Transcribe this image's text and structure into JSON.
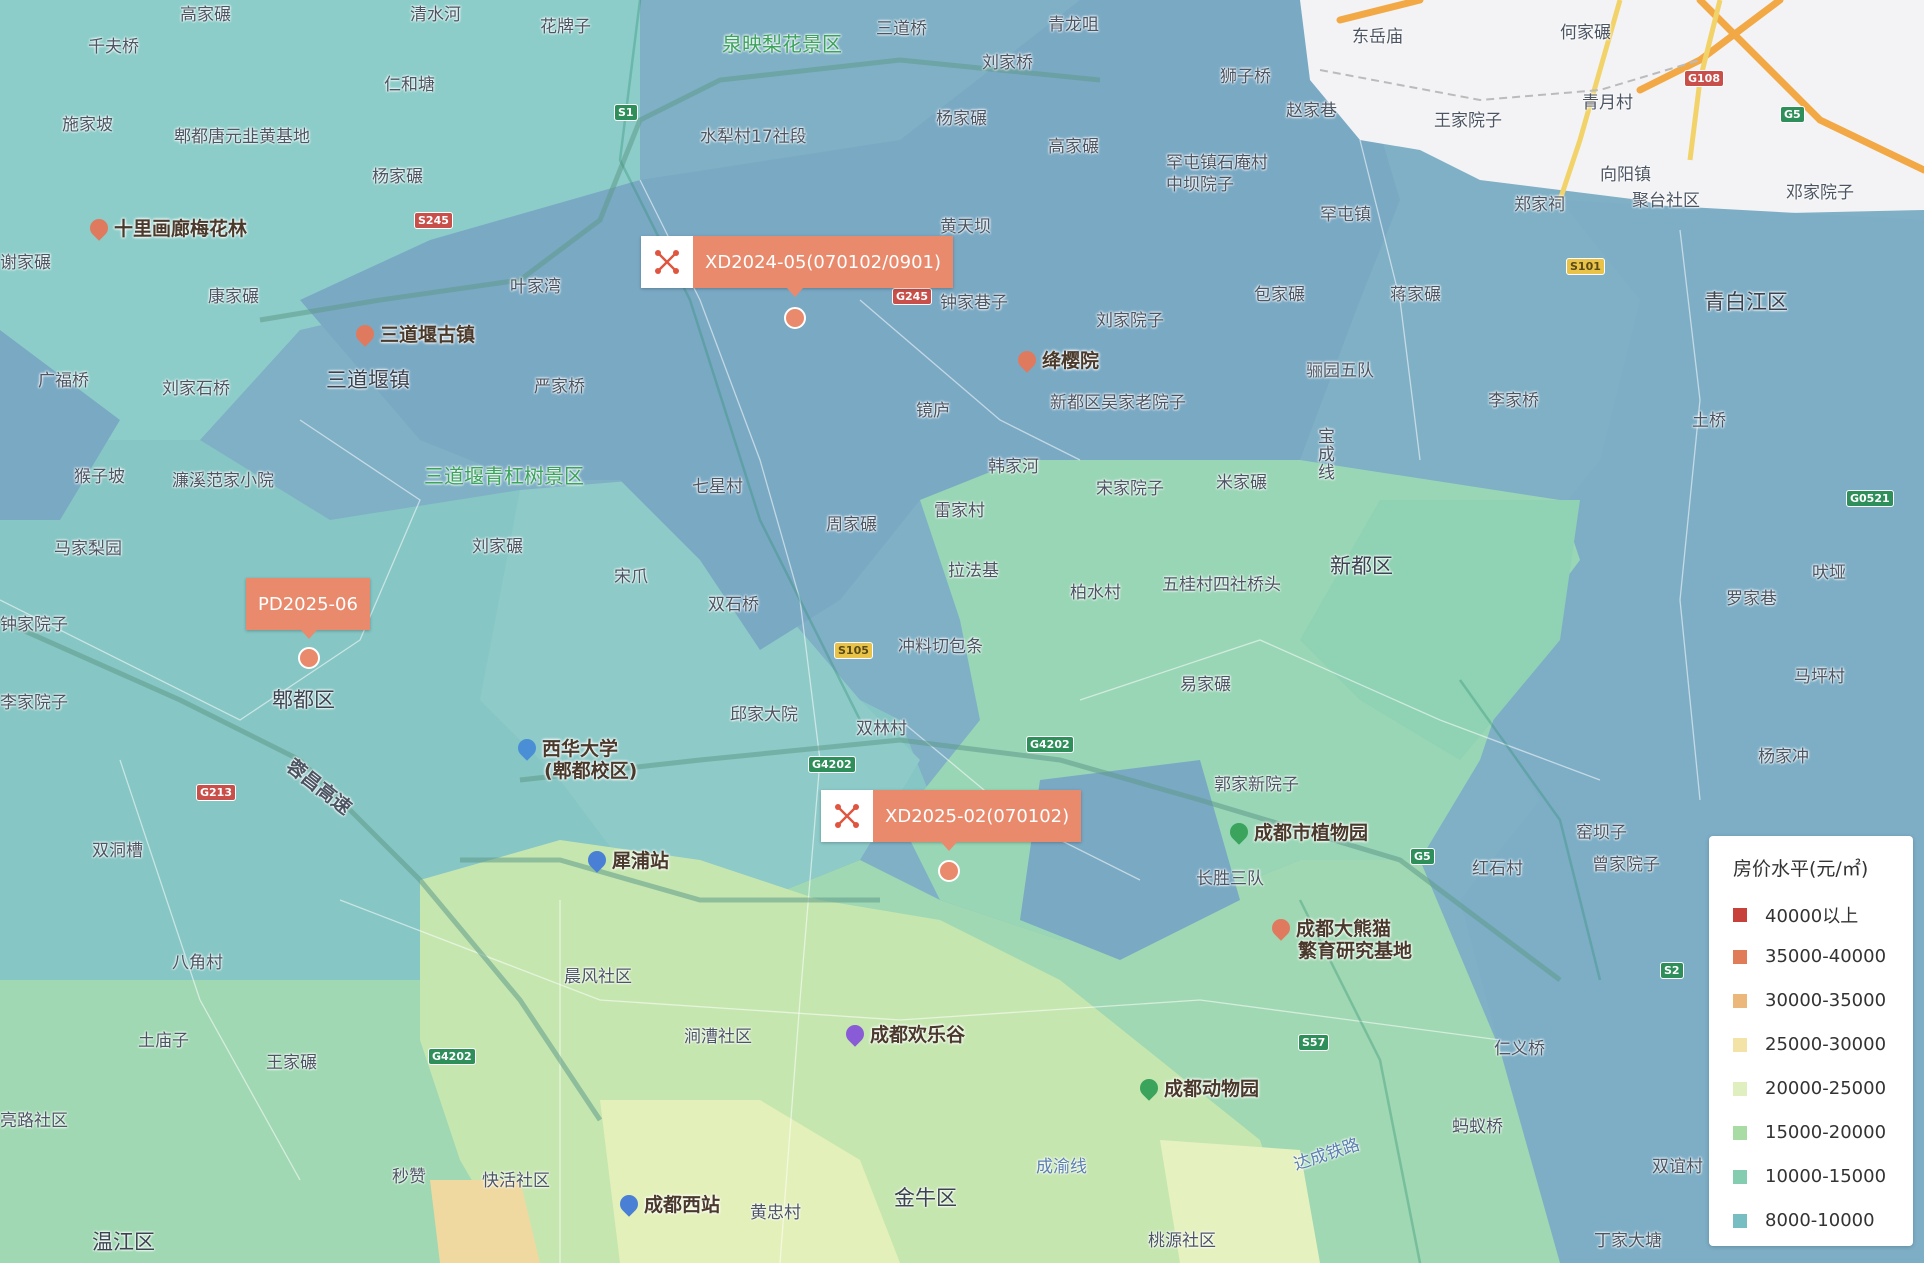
{
  "map": {
    "markers": [
      {
        "name": "marker-xd2024-05",
        "label": "XD2024-05(070102/0901)",
        "has_icon": true,
        "icon": "land-parcel-icon"
      },
      {
        "name": "marker-pd2025-06",
        "label": "PD2025-06",
        "has_icon": false
      },
      {
        "name": "marker-xd2025-02",
        "label": "XD2025-02(070102)",
        "has_icon": true,
        "icon": "land-parcel-icon"
      }
    ],
    "marker_color": "#e98a6d",
    "places": [
      "高家碾",
      "清水河",
      "花牌子",
      "泉映梨花景区",
      "三道桥",
      "青龙咀",
      "东岳庙",
      "何家碾",
      "千夫桥",
      "仁和塘",
      "刘家桥",
      "狮子桥",
      "施家坡",
      "郫都唐元韭黄基地",
      "水犁村17社段",
      "杨家碾",
      "高家碾",
      "赵家巷",
      "王家院子",
      "青月村",
      "杨家碾",
      "罕屯镇石庵村中坝院子",
      "向阳镇",
      "郑家祠",
      "聚台社区",
      "邓家院子",
      "谢家碾",
      "叶家湾",
      "黄天坝",
      "罕屯镇",
      "康家碾",
      "钟家巷子",
      "刘家院子",
      "包家碾",
      "蒋家碾",
      "青白江区",
      "广福桥",
      "刘家石桥",
      "三道堰镇",
      "严家桥",
      "镜庐",
      "新都区吴家老院子",
      "骊园五队",
      "李家桥",
      "土桥",
      "猴子坡",
      "濂溪范家小院",
      "七星村",
      "韩家河",
      "宋家院子",
      "米家碾",
      "宝成线",
      "马家梨园",
      "刘家碾",
      "周家碾",
      "雷家村",
      "新都区",
      "吠垭",
      "宋爪",
      "双石桥",
      "拉法基",
      "柏水村",
      "五桂村四社桥头",
      "罗家巷",
      "钟家院子",
      "冲料切包条",
      "易家碾",
      "马坪村",
      "郫都区",
      "李家院子",
      "邱家大院",
      "双林村",
      "郭家新院子",
      "杨家冲",
      "蓉昌高速",
      "双洞槽",
      "长胜三队",
      "窑坝子",
      "红石村",
      "曾家院子",
      "八角村",
      "晨风社区",
      "土庙子",
      "涧漕社区",
      "仁义桥",
      "王家碾",
      "成渝线",
      "达成铁路",
      "蚂蚁桥",
      "双谊村",
      "亮路社区",
      "秒赞",
      "快活社区",
      "黄忠村",
      "金牛区",
      "桃源社区",
      "丁家大塘",
      "温江区",
      "三道堰青杠树景区"
    ],
    "pois": [
      {
        "name": "十里画廊梅花林",
        "icon": "scenic-pin-icon",
        "color": "#e07a5f"
      },
      {
        "name": "三道堰古镇",
        "icon": "scenic-pin-icon",
        "color": "#e07a5f"
      },
      {
        "name": "绛樱院",
        "icon": "scenic-pin-icon",
        "color": "#e07a5f"
      },
      {
        "name": "西华大学",
        "sub": "(郫都校区)",
        "icon": "school-pin-icon",
        "color": "#4a8fd6"
      },
      {
        "name": "犀浦站",
        "icon": "metro-station-icon",
        "color": "#4a7fd6"
      },
      {
        "name": "成都市植物园",
        "icon": "park-pin-icon",
        "color": "#3aa35c"
      },
      {
        "name": "成都大熊猫",
        "sub": "繁育研究基地",
        "icon": "scenic-pin-icon",
        "color": "#e07a5f"
      },
      {
        "name": "成都欢乐谷",
        "icon": "amusement-pin-icon",
        "color": "#8a5bd6"
      },
      {
        "name": "成都动物园",
        "icon": "zoo-pin-icon",
        "color": "#3aa35c"
      },
      {
        "name": "成都西站",
        "icon": "railway-station-icon",
        "color": "#4a7fd6"
      }
    ],
    "highways": [
      "S1",
      "G108",
      "G5",
      "G245",
      "S245",
      "S101",
      "G0521",
      "S105",
      "G4202",
      "G4202",
      "G213",
      "G5",
      "G4202",
      "S57",
      "S2"
    ]
  },
  "legend": {
    "title": "房价水平(元/㎡)",
    "items": [
      {
        "label": "40000以上",
        "color": "#c8403a"
      },
      {
        "label": "35000-40000",
        "color": "#e07c57"
      },
      {
        "label": "30000-35000",
        "color": "#ecb77b"
      },
      {
        "label": "25000-30000",
        "color": "#f4e3a6"
      },
      {
        "label": "20000-25000",
        "color": "#e0efbf"
      },
      {
        "label": "15000-20000",
        "color": "#a9dca4"
      },
      {
        "label": "10000-15000",
        "color": "#84cdb1"
      },
      {
        "label": "8000-10000",
        "color": "#76bec2"
      }
    ]
  }
}
